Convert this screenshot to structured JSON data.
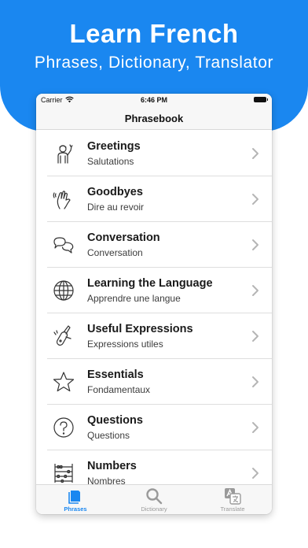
{
  "hero": {
    "title": "Learn French",
    "subtitle": "Phrases, Dictionary, Translator"
  },
  "status_bar": {
    "carrier": "Carrier",
    "time": "6:46 PM"
  },
  "nav": {
    "title": "Phrasebook"
  },
  "colors": {
    "accent": "#1a87f0",
    "tab_inactive": "#9a9a9a",
    "icon_stroke": "#333333"
  },
  "categories": [
    {
      "title": "Greetings",
      "subtitle": "Salutations",
      "icon": "waving-person-icon"
    },
    {
      "title": "Goodbyes",
      "subtitle": "Dire au revoir",
      "icon": "waving-hand-icon"
    },
    {
      "title": "Conversation",
      "subtitle": "Conversation",
      "icon": "speech-bubbles-icon"
    },
    {
      "title": "Learning the Language",
      "subtitle": "Apprendre une langue",
      "icon": "globe-icon"
    },
    {
      "title": "Useful Expressions",
      "subtitle": "Expressions utiles",
      "icon": "swiss-knife-icon"
    },
    {
      "title": "Essentials",
      "subtitle": "Fondamentaux",
      "icon": "star-icon"
    },
    {
      "title": "Questions",
      "subtitle": "Questions",
      "icon": "question-circle-icon"
    },
    {
      "title": "Numbers",
      "subtitle": "Nombres",
      "icon": "abacus-icon"
    }
  ],
  "tabs": [
    {
      "label": "Phrases",
      "icon": "phrases-icon",
      "active": true
    },
    {
      "label": "Dictionary",
      "icon": "magnifier-icon",
      "active": false
    },
    {
      "label": "Translate",
      "icon": "translate-icon",
      "active": false
    }
  ]
}
